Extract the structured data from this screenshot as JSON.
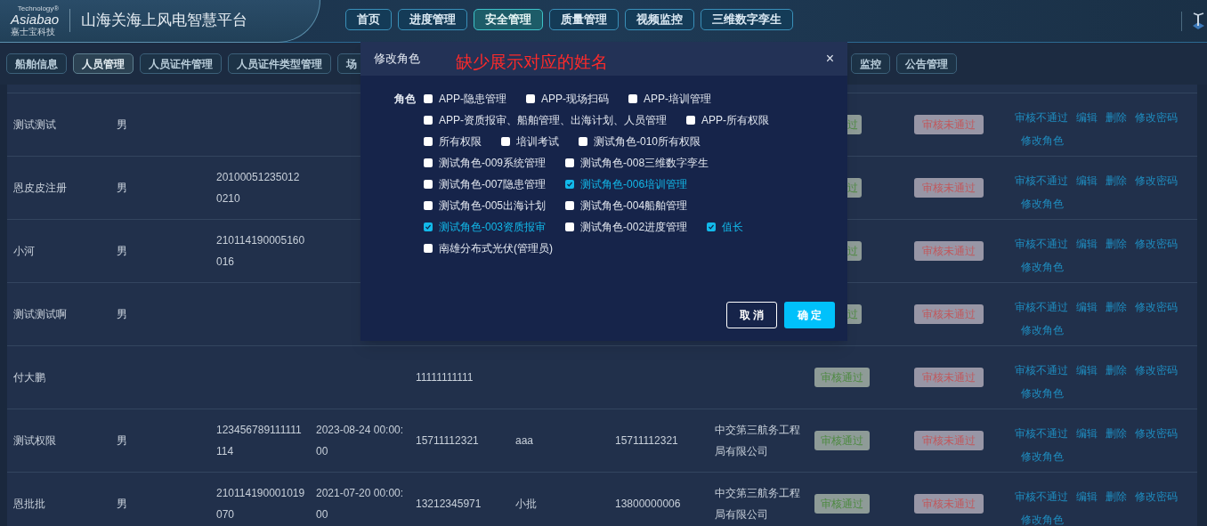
{
  "header": {
    "logo": {
      "wordmark": "Asiabao",
      "tagline": "Technology®",
      "company": "嘉士宝科技"
    },
    "title": "山海关海上风电智慧平台",
    "nav": [
      {
        "label": "首页",
        "selected": false
      },
      {
        "label": "进度管理",
        "selected": false
      },
      {
        "label": "安全管理",
        "selected": true
      },
      {
        "label": "质量管理",
        "selected": false
      },
      {
        "label": "视频监控",
        "selected": false
      },
      {
        "label": "三维数字孪生",
        "selected": false
      }
    ]
  },
  "subnav_left": [
    {
      "label": "船舶信息",
      "selected": false
    },
    {
      "label": "人员管理",
      "selected": true
    },
    {
      "label": "人员证件管理",
      "selected": false
    },
    {
      "label": "人员证件类型管理",
      "selected": false
    },
    {
      "label": "场",
      "selected": false
    }
  ],
  "subnav_right": [
    {
      "label": "监控",
      "selected": false
    },
    {
      "label": "公告管理",
      "selected": false
    }
  ],
  "table": {
    "rows": [
      {
        "name": "测试测试",
        "gender": "男",
        "approval": {
          "text": "过",
          "kind": "partial"
        },
        "rejection": "审核未通过",
        "actions": [
          "审核不通过",
          "编辑",
          "删除",
          "修改密码",
          "修改角色"
        ]
      },
      {
        "name": "恩皮皮注册",
        "gender": "男",
        "id_number": "201000512350120210",
        "approval": {
          "text": "过",
          "kind": "partial"
        },
        "rejection": "审核未通过",
        "actions": [
          "审核不通过",
          "编辑",
          "删除",
          "修改密码",
          "修改角色"
        ]
      },
      {
        "name": "小河",
        "gender": "男",
        "id_number": "210114190005160016",
        "approval": {
          "text": "过",
          "kind": "partial"
        },
        "rejection": "审核未通过",
        "actions": [
          "审核不通过",
          "编辑",
          "删除",
          "修改密码",
          "修改角色"
        ]
      },
      {
        "name": "测试测试啊",
        "gender": "男",
        "approval": {
          "text": "过",
          "kind": "partial"
        },
        "rejection": "审核未通过",
        "actions": [
          "审核不通过",
          "编辑",
          "删除",
          "修改密码",
          "修改角色"
        ]
      },
      {
        "name": "付大鹏",
        "phone": "11111111111",
        "approval": {
          "text": "审核通过",
          "kind": "full"
        },
        "rejection": "审核未通过",
        "actions": [
          "审核不通过",
          "编辑",
          "删除",
          "修改密码",
          "修改角色"
        ]
      },
      {
        "name": "测试权限",
        "gender": "男",
        "id_number": "123456789111111114",
        "date": "2023-08-24 00:00:00",
        "phone": "15711112321",
        "column_6": "aaa",
        "phone_2": "15711112321",
        "company": "中交第三航务工程局有限公司",
        "approval": {
          "text": "审核通过",
          "kind": "full"
        },
        "rejection": "审核未通过",
        "actions": [
          "审核不通过",
          "编辑",
          "删除",
          "修改密码",
          "修改角色"
        ]
      },
      {
        "name": "恩批批",
        "gender": "男",
        "id_number": "210114190001019070",
        "date": "2021-07-20 00:00:00",
        "phone": "13212345971",
        "column_6": "小批",
        "phone_2": "13800000006",
        "company": "中交第三航务工程局有限公司",
        "approval": {
          "text": "审核通过",
          "kind": "full"
        },
        "rejection": "审核未通过",
        "actions": [
          "审核不通过",
          "编辑",
          "删除",
          "修改密码",
          "修改角色"
        ]
      }
    ]
  },
  "dialog": {
    "title": "修改角色",
    "close": "×",
    "annotation": "缺少展示对应的姓名",
    "field_label": "角色",
    "role_rows": [
      [
        {
          "label": "APP-隐患管理",
          "checked": false
        },
        {
          "label": "APP-现场扫码",
          "checked": false
        },
        {
          "label": "APP-培训管理",
          "checked": false
        }
      ],
      [
        {
          "label": "APP-资质报审、船舶管理、出海计划、人员管理",
          "checked": false
        },
        {
          "label": "APP-所有权限",
          "checked": false
        }
      ],
      [
        {
          "label": "所有权限",
          "checked": false
        },
        {
          "label": "培训考试",
          "checked": false
        },
        {
          "label": "测试角色-010所有权限",
          "checked": false
        }
      ],
      [
        {
          "label": "测试角色-009系统管理",
          "checked": false
        },
        {
          "label": "测试角色-008三维数字孪生",
          "checked": false
        }
      ],
      [
        {
          "label": "测试角色-007隐患管理",
          "checked": false
        },
        {
          "label": "测试角色-006培训管理",
          "checked": true
        }
      ],
      [
        {
          "label": "测试角色-005出海计划",
          "checked": false
        },
        {
          "label": "测试角色-004船舶管理",
          "checked": false
        }
      ],
      [
        {
          "label": "测试角色-003资质报审",
          "checked": true
        },
        {
          "label": "测试角色-002进度管理",
          "checked": false
        },
        {
          "label": "值长",
          "checked": true
        }
      ],
      [
        {
          "label": "南雄分布式光伏(管理员)",
          "checked": false
        }
      ]
    ],
    "cancel": "取 消",
    "confirm": "确 定"
  }
}
